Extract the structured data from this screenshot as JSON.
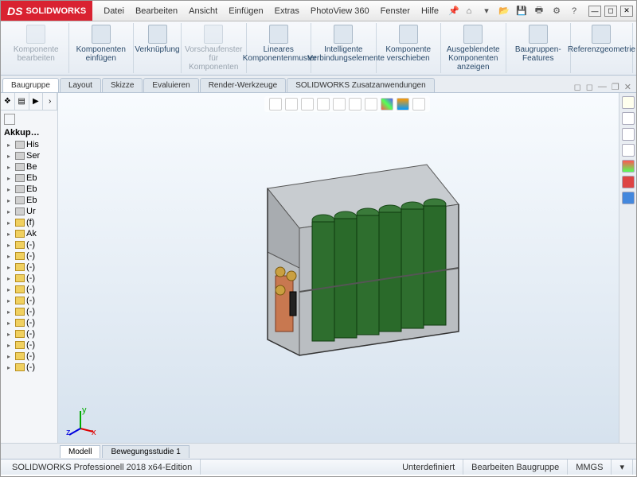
{
  "app": {
    "brand_prefix": "SOLID",
    "brand_suffix": "WORKS"
  },
  "menu": [
    "Datei",
    "Bearbeiten",
    "Ansicht",
    "Einfügen",
    "Extras",
    "PhotoView 360",
    "Fenster",
    "Hilfe"
  ],
  "ribbon": [
    {
      "label": "Komponente bearbeiten",
      "disabled": true
    },
    {
      "label": "Komponenten einfügen",
      "disabled": false
    },
    {
      "label": "Verknüpfung",
      "disabled": false
    },
    {
      "label": "Vorschaufenster für Komponenten",
      "disabled": true
    },
    {
      "label": "Lineares Komponentenmuster",
      "disabled": false
    },
    {
      "label": "Intelligente Verbindungselemente",
      "disabled": false
    },
    {
      "label": "Komponente verschieben",
      "disabled": false
    },
    {
      "label": "Ausgeblendete Komponenten anzeigen",
      "disabled": false
    },
    {
      "label": "Baugruppen-Features",
      "disabled": false
    },
    {
      "label": "Referenzgeometrie",
      "disabled": false
    }
  ],
  "tabs": [
    "Baugruppe",
    "Layout",
    "Skizze",
    "Evaluieren",
    "Render-Werkzeuge",
    "SOLIDWORKS Zusatzanwendungen"
  ],
  "active_tab": "Baugruppe",
  "tree": {
    "root": "Akkup…",
    "items": [
      {
        "t": "His",
        "i": "g"
      },
      {
        "t": "Ser",
        "i": "g"
      },
      {
        "t": "Be",
        "i": "g"
      },
      {
        "t": "Eb",
        "i": "g"
      },
      {
        "t": "Eb",
        "i": "g"
      },
      {
        "t": "Eb",
        "i": "g"
      },
      {
        "t": "Ur",
        "i": "g"
      },
      {
        "t": "(f)",
        "i": "y"
      },
      {
        "t": "Ak",
        "i": "y"
      },
      {
        "t": "(-)",
        "i": "y"
      },
      {
        "t": "(-)",
        "i": "y"
      },
      {
        "t": "(-)",
        "i": "y"
      },
      {
        "t": "(-)",
        "i": "y"
      },
      {
        "t": "(-)",
        "i": "y"
      },
      {
        "t": "(-)",
        "i": "y"
      },
      {
        "t": "(-)",
        "i": "y"
      },
      {
        "t": "(-)",
        "i": "y"
      },
      {
        "t": "(-)",
        "i": "y"
      },
      {
        "t": "(-)",
        "i": "y"
      },
      {
        "t": "(-)",
        "i": "y"
      },
      {
        "t": "(-)",
        "i": "y"
      }
    ]
  },
  "bottom_tabs": [
    "Modell",
    "Bewegungsstudie 1"
  ],
  "active_bottom_tab": "Modell",
  "status": {
    "left": "SOLIDWORKS Professionell 2018 x64-Edition",
    "c1": "Unterdefiniert",
    "c2": "Bearbeiten Baugruppe",
    "c3": "MMGS"
  },
  "triad": {
    "x": "x",
    "y": "y",
    "z": "z"
  }
}
